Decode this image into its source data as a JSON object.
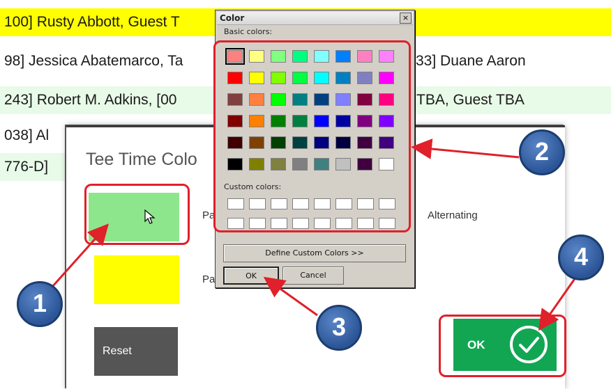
{
  "rows": [
    {
      "left": "100] Rusty Abbott, Guest T",
      "right": "",
      "bg": "#ffff00"
    },
    {
      "left": "98] Jessica Abatemarco, Ta",
      "right": "33] Duane Aaron",
      "bg": "#ffffff"
    },
    {
      "left": "243] Robert M. Adkins, [00",
      "right": "TBA, Guest TBA",
      "bg": "#e8fae8"
    },
    {
      "left": "038]  Al",
      "right": "",
      "bg": "#ffffff"
    },
    {
      "left": "776-D]",
      "right": "",
      "bg": "#e8fae8"
    }
  ],
  "tee_dialog": {
    "title": "Tee Time Colo",
    "swatch1_color": "#8ee68c",
    "swatch2_color": "#ffff00",
    "label_pa_1": "Pa",
    "label_pa_2": "Pa",
    "alternating_label": "Alternating",
    "reset_label": "Reset",
    "ok_label": "OK"
  },
  "color_dialog": {
    "title": "Color",
    "close_glyph": "×",
    "basic_colors_label": "Basic colors:",
    "custom_colors_label": "Custom colors:",
    "define_button": "Define Custom Colors >>",
    "ok_button": "OK",
    "cancel_button": "Cancel",
    "basic_colors": [
      [
        "#ff8080",
        "#ffff80",
        "#80ff80",
        "#00ff80",
        "#80ffff",
        "#0080ff",
        "#ff80c0",
        "#ff80ff"
      ],
      [
        "#ff0000",
        "#ffff00",
        "#80ff00",
        "#00ff40",
        "#00ffff",
        "#0080c0",
        "#8080c0",
        "#ff00ff"
      ],
      [
        "#804040",
        "#ff8040",
        "#00ff00",
        "#008080",
        "#004080",
        "#8080ff",
        "#800040",
        "#ff0080"
      ],
      [
        "#800000",
        "#ff8000",
        "#008000",
        "#008040",
        "#0000ff",
        "#0000a0",
        "#800080",
        "#8000ff"
      ],
      [
        "#400000",
        "#804000",
        "#004000",
        "#004040",
        "#000080",
        "#000040",
        "#400040",
        "#400080"
      ],
      [
        "#000000",
        "#808000",
        "#808040",
        "#808080",
        "#408080",
        "#c0c0c0",
        "#400040",
        "#ffffff"
      ]
    ],
    "custom_colors": [
      [
        "#ffffff",
        "#ffffff",
        "#ffffff",
        "#ffffff",
        "#ffffff",
        "#ffffff",
        "#ffffff",
        "#ffffff"
      ],
      [
        "#ffffff",
        "#ffffff",
        "#ffffff",
        "#ffffff",
        "#ffffff",
        "#ffffff",
        "#ffffff",
        "#ffffff"
      ]
    ]
  },
  "annotations": {
    "badge_1": "1",
    "badge_2": "2",
    "badge_3": "3",
    "badge_4": "4",
    "accent_color": "#e0202a",
    "badge_color": "#2b5597"
  },
  "icons": {
    "cursor": "mouse-pointer-icon",
    "ok_check": "check-circle-icon"
  }
}
